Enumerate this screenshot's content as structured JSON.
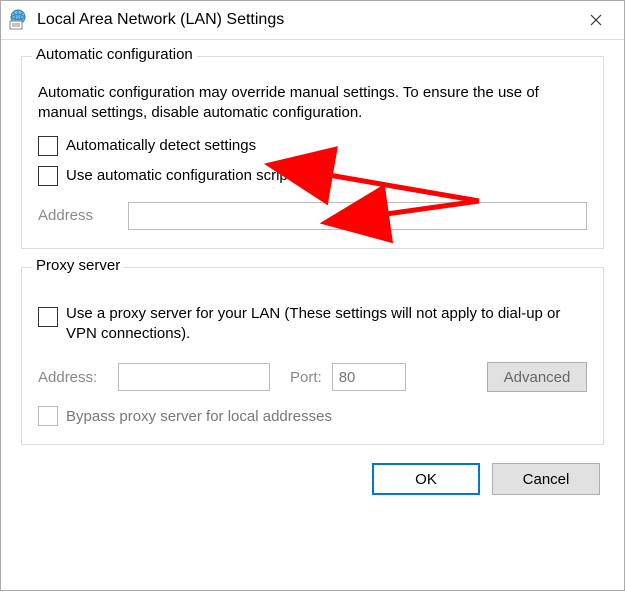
{
  "title": "Local Area Network (LAN) Settings",
  "group_auto": {
    "legend": "Automatic configuration",
    "description": "Automatic configuration may override manual settings.  To ensure the use of manual settings, disable automatic configuration.",
    "auto_detect_label": "Automatically detect settings",
    "auto_script_label": "Use automatic configuration script",
    "address_label": "Address"
  },
  "group_proxy": {
    "legend": "Proxy server",
    "use_proxy_label": "Use a proxy server for your LAN (These settings will not apply to dial-up or VPN connections).",
    "address_label": "Address:",
    "port_label": "Port:",
    "port_value": "80",
    "advanced_label": "Advanced",
    "bypass_label": "Bypass proxy server for local addresses"
  },
  "buttons": {
    "ok": "OK",
    "cancel": "Cancel"
  }
}
